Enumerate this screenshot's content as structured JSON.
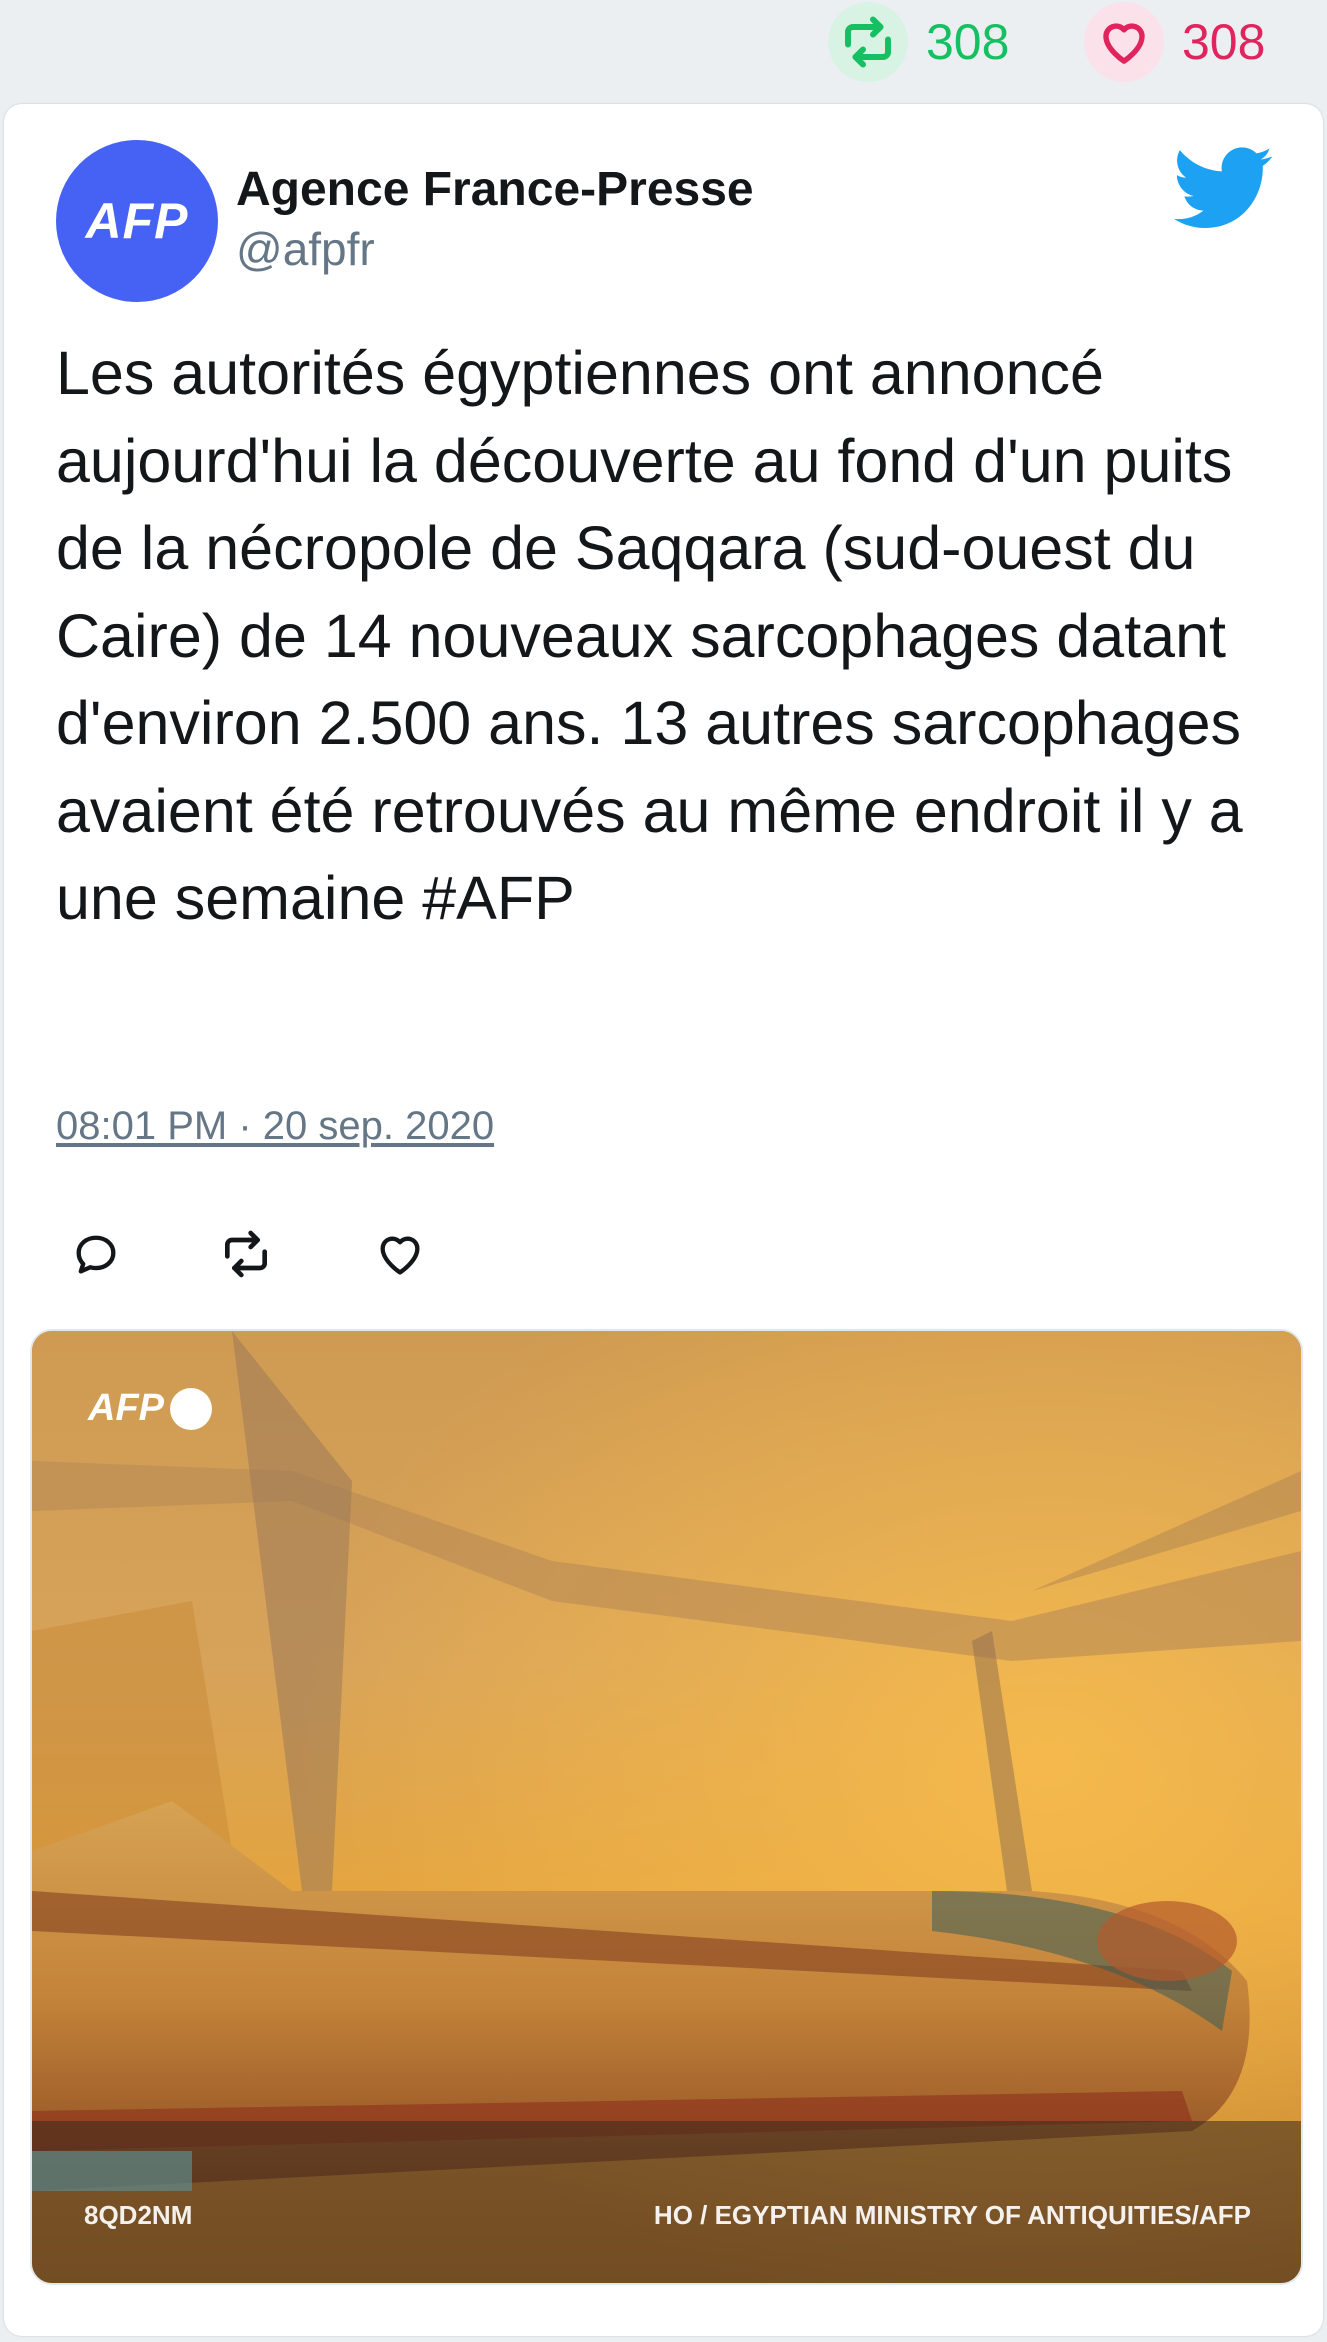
{
  "stats": {
    "retweet_icon": "retweet-icon",
    "retweets": "308",
    "like_icon": "heart-icon",
    "likes": "308",
    "retweet_color": "#17bf63",
    "like_color": "#e0245e"
  },
  "tweet": {
    "author_name": "Agence France-Presse",
    "author_handle": "@afpfr",
    "avatar_text": "AFP",
    "avatar_color": "#4562f5",
    "brand_icon": "twitter-bird-icon",
    "text": "Les autorités égyptiennes ont annoncé aujourd'hui la découverte au fond d'un puits de la nécropole de Saqqara (sud-ouest du Caire) de 14 nouveaux sarcophages datant d'environ 2.500 ans. 13 autres sarcophages avaient été retrouvés au même endroit il y a une semaine #AFP",
    "timestamp": "08:01 PM · 20 sep. 2020",
    "actions": [
      "reply-icon",
      "retweet-icon",
      "heart-icon"
    ]
  },
  "media": {
    "watermark": "AFP",
    "caption_left": "8QD2NM",
    "caption_right": "HO / EGYPTIAN MINISTRY OF ANTIQUITIES/AFP"
  }
}
